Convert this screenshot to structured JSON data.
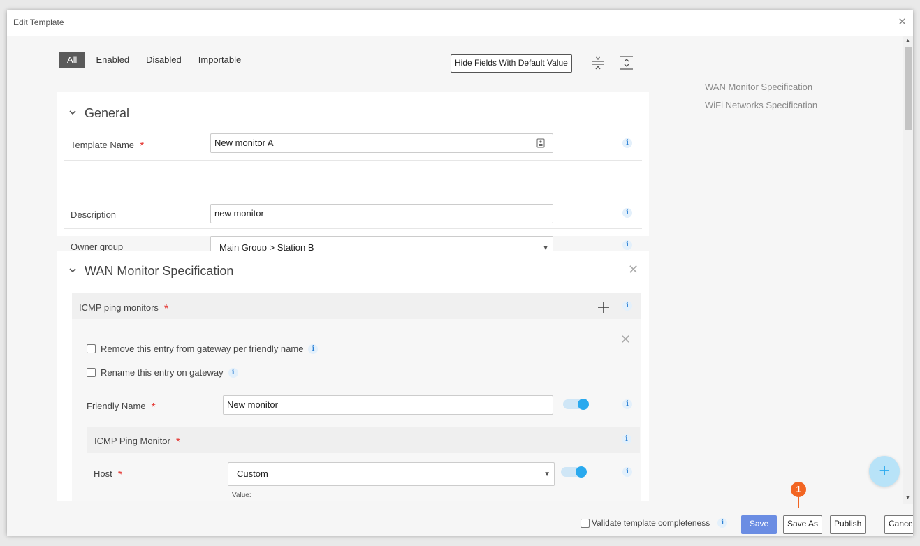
{
  "window": {
    "title": "Edit Template",
    "close": "✕"
  },
  "filters": {
    "tabs": [
      "All",
      "Enabled",
      "Disabled",
      "Importable"
    ],
    "active": "All"
  },
  "toolbar": {
    "hide_defaults_label": "Hide Fields With Default Value"
  },
  "toc": {
    "items": [
      "WAN Monitor Specification",
      "WiFi Networks Specification"
    ]
  },
  "general": {
    "title": "General",
    "template_name": {
      "label": "Template Name",
      "value": "New monitor A"
    },
    "description": {
      "label": "Description",
      "value": "new monitor"
    },
    "owner_group": {
      "label": "Owner group",
      "value": "Main Group > Station B"
    }
  },
  "wan": {
    "title": "WAN Monitor Specification",
    "icmp_ping_monitors": {
      "label": "ICMP ping monitors"
    },
    "entry": {
      "remove_label": "Remove this entry from gateway per friendly name",
      "rename_label": "Rename this entry on gateway",
      "friendly_name": {
        "label": "Friendly Name",
        "value": "New monitor"
      },
      "icmp_ping_monitor": {
        "label": "ICMP Ping Monitor"
      },
      "host": {
        "label": "Host",
        "value": "Custom",
        "value_label": "Value:"
      }
    }
  },
  "footer": {
    "validate_label": "Validate template completeness",
    "save": "Save",
    "save_as": "Save As",
    "publish": "Publish",
    "cancel": "Cancel"
  },
  "callout": {
    "number": "1"
  },
  "colors": {
    "primary": "#6b8de3",
    "toggle": "#29a9ee",
    "required": "#e53935",
    "callout": "#f26522"
  }
}
